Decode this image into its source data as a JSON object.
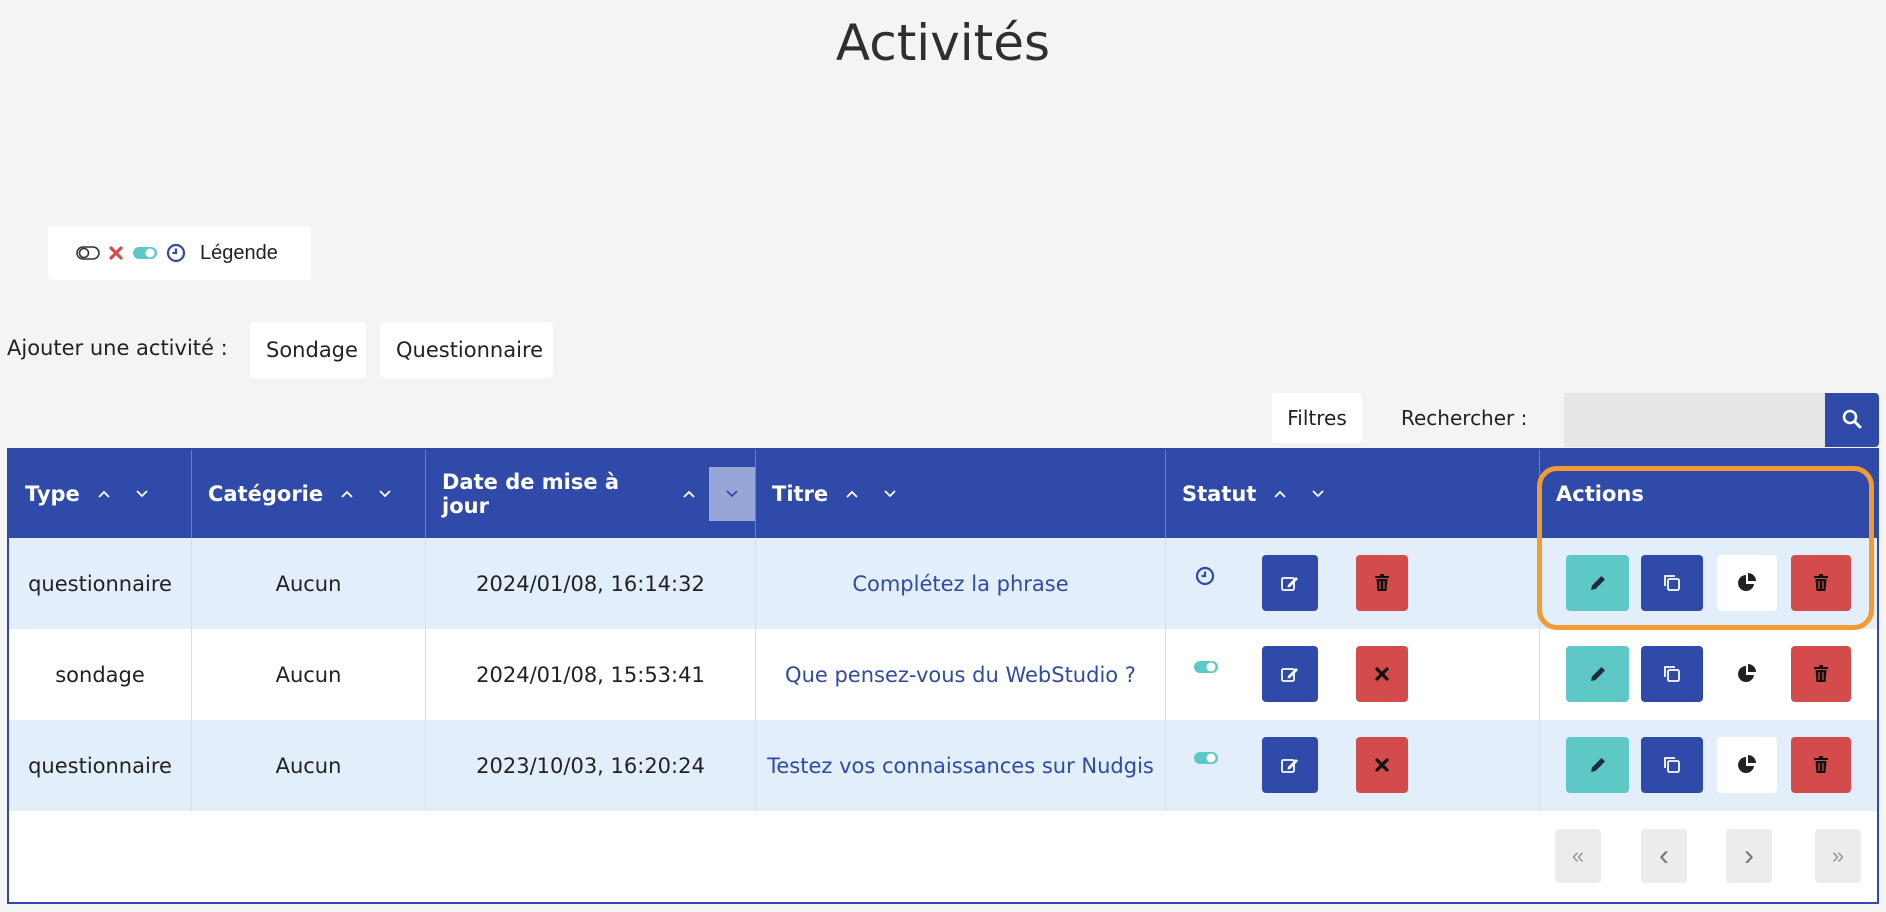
{
  "page": {
    "title": "Activités"
  },
  "legend": {
    "label": "Légende",
    "icons": [
      "toggle-off-icon",
      "x-icon",
      "toggle-on-icon",
      "clock-icon"
    ]
  },
  "add_activity": {
    "label": "Ajouter une activité :",
    "buttons": [
      "Sondage",
      "Questionnaire"
    ]
  },
  "toolbar": {
    "filters_label": "Filtres",
    "search_label": "Rechercher :",
    "search_value": "",
    "search_icon": "search-icon"
  },
  "table": {
    "columns": [
      "Type",
      "Catégorie",
      "Date de mise à jour",
      "Titre",
      "Statut",
      "Actions"
    ],
    "rows": [
      {
        "type": "questionnaire",
        "category": "Aucun",
        "updated": "2024/01/08, 16:14:32",
        "title": "Complétez la phrase",
        "status": "clock-icon"
      },
      {
        "type": "sondage",
        "category": "Aucun",
        "updated": "2024/01/08, 15:53:41",
        "title": "Que pensez-vous du WebStudio ?",
        "status": "toggle-on-icon"
      },
      {
        "type": "questionnaire",
        "category": "Aucun",
        "updated": "2023/10/03, 16:20:24",
        "title": "Testez vos connaissances sur Nudgis",
        "status": "toggle-on-icon"
      }
    ]
  },
  "pagination": {
    "first": "«",
    "prev": "‹",
    "next": "›",
    "last": "»"
  },
  "colors": {
    "primary": "#2f4aa8",
    "danger": "#d34b4b",
    "teal": "#5ec8c6",
    "highlight": "#f29b30",
    "row_alt": "#e2eefa"
  }
}
